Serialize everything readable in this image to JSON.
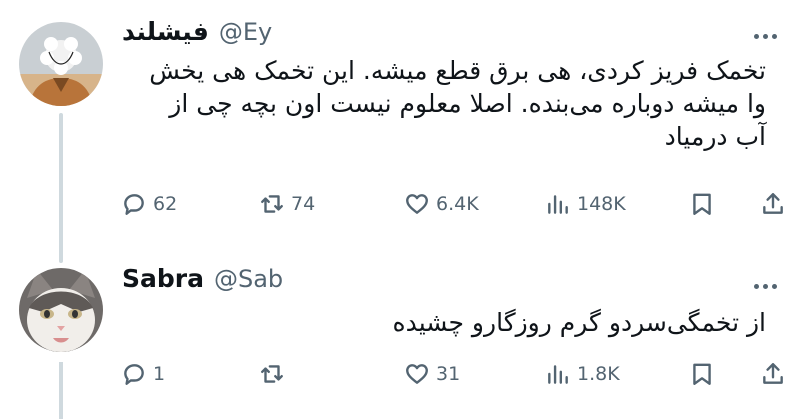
{
  "tweets": [
    {
      "display_name": "فیشلند",
      "handle": "@Ey",
      "text": "تخمک فریز کردی، هی برق قطع میشه. این تخمک هی یخش وا میشه دوباره می‌بنده. اصلا معلوم نیست اون بچه چی از آب درمیاد",
      "avatar_icon": "person-avatar",
      "stats": {
        "replies": "62",
        "retweets": "74",
        "likes": "6.4K",
        "views": "148K"
      }
    },
    {
      "display_name": "Sabra",
      "handle": "@Sab",
      "text": "از تخمگی‌سردو گرم روزگارو چشیده",
      "avatar_icon": "cat-avatar",
      "stats": {
        "replies": "1",
        "retweets": "",
        "likes": "31",
        "views": "1.8K"
      }
    }
  ],
  "icons": {
    "reply": "reply-icon",
    "retweet": "retweet-icon",
    "like": "heart-icon",
    "views": "views-icon",
    "bookmark": "bookmark-icon",
    "share": "share-icon",
    "more": "more-icon"
  },
  "colors": {
    "text": "#0f1419",
    "secondary": "#536471",
    "thread_line": "#cfd9de",
    "background": "#ffffff"
  }
}
